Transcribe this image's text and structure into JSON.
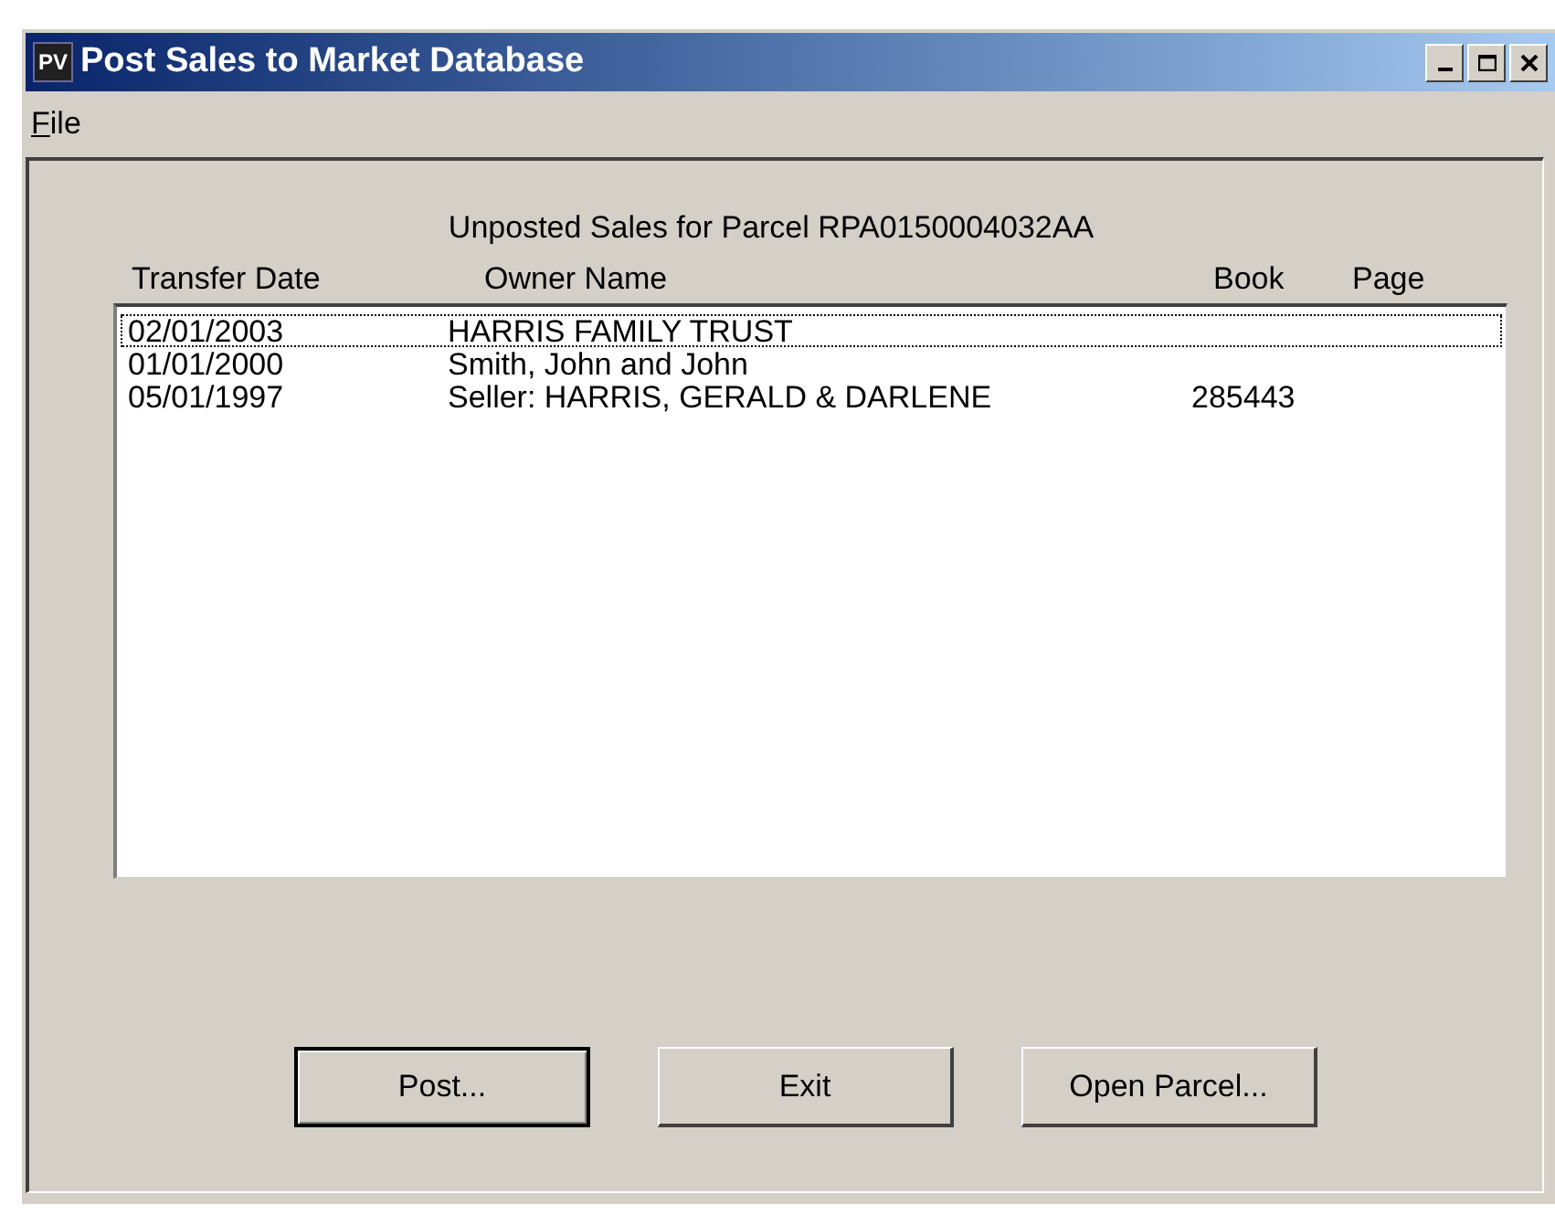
{
  "window": {
    "title": "Post Sales to Market Database",
    "app_icon": "PV"
  },
  "menu": [
    {
      "label": "File",
      "underline_first": true
    }
  ],
  "heading": "Unposted Sales for Parcel RPA0150004032AA",
  "columns": [
    "Transfer Date",
    "Owner Name",
    "Book",
    "Page"
  ],
  "rows": [
    {
      "date": "02/01/2003",
      "owner": "HARRIS FAMILY TRUST",
      "selected": true
    },
    {
      "date": "01/01/2000",
      "owner": "Smith, John and John",
      "selected": false
    },
    {
      "date": "05/01/1997",
      "owner": "Seller: HARRIS, GERALD & DARLENE",
      "book": "285443",
      "selected": false
    }
  ],
  "buttons": [
    {
      "label": "Post...",
      "default": true
    },
    {
      "label": "Exit",
      "default": false
    },
    {
      "label": "Open Parcel...",
      "default": false
    }
  ]
}
